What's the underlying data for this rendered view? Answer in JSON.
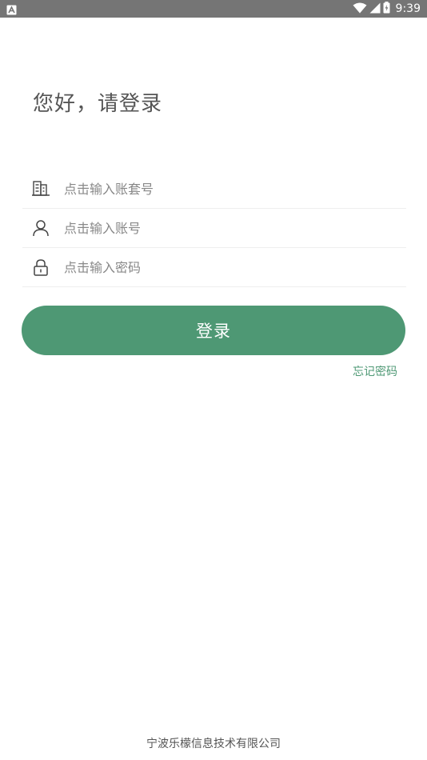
{
  "status_bar": {
    "time": "9:39"
  },
  "login": {
    "greeting": "您好，请登录",
    "fields": {
      "account_set": {
        "placeholder": "点击输入账套号",
        "value": ""
      },
      "account": {
        "placeholder": "点击输入账号",
        "value": ""
      },
      "password": {
        "placeholder": "点击输入密码",
        "value": ""
      }
    },
    "login_label": "登录",
    "forgot_password_label": "忘记密码"
  },
  "footer": {
    "company": "宁波乐檬信息技术有限公司"
  },
  "colors": {
    "accent": "#4e9874",
    "status_bar": "#757575"
  }
}
